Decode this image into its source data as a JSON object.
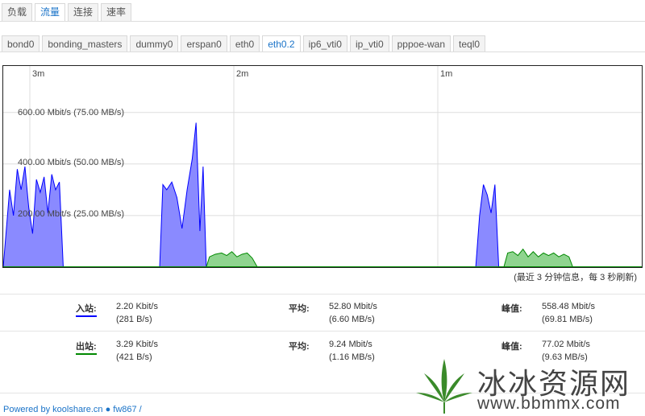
{
  "tabs": [
    {
      "label": "负载",
      "active": false
    },
    {
      "label": "流量",
      "active": true
    },
    {
      "label": "连接",
      "active": false
    },
    {
      "label": "速率",
      "active": false
    }
  ],
  "interfaces": [
    {
      "label": "bond0",
      "active": false
    },
    {
      "label": "bonding_masters",
      "active": false
    },
    {
      "label": "dummy0",
      "active": false
    },
    {
      "label": "erspan0",
      "active": false
    },
    {
      "label": "eth0",
      "active": false
    },
    {
      "label": "eth0.2",
      "active": true
    },
    {
      "label": "ip6_vti0",
      "active": false
    },
    {
      "label": "ip_vti0",
      "active": false
    },
    {
      "label": "pppoe-wan",
      "active": false
    },
    {
      "label": "teql0",
      "active": false
    }
  ],
  "chart": {
    "time_labels": [
      "3m",
      "2m",
      "1m"
    ],
    "y_labels": [
      "600.00 Mbit/s (75.00 MB/s)",
      "400.00 Mbit/s (50.00 MB/s)",
      "200.00 Mbit/s (25.00 MB/s)"
    ],
    "note": "(最近 3 分钟信息，每 3 秒刷新)"
  },
  "chart_data": {
    "type": "area",
    "ylabel": "Mbit/s",
    "ylim": [
      0,
      780
    ],
    "series": [
      {
        "name": "入站",
        "color": "#0000ff",
        "fill": "#8a8aff",
        "points": [
          [
            0,
            0
          ],
          [
            1.0,
            300
          ],
          [
            1.6,
            200
          ],
          [
            2.2,
            380
          ],
          [
            2.8,
            300
          ],
          [
            3.4,
            390
          ],
          [
            4.0,
            230
          ],
          [
            4.6,
            130
          ],
          [
            5.2,
            340
          ],
          [
            5.8,
            290
          ],
          [
            6.4,
            350
          ],
          [
            7.0,
            210
          ],
          [
            7.6,
            360
          ],
          [
            8.2,
            300
          ],
          [
            8.8,
            330
          ],
          [
            9.4,
            0
          ],
          [
            24.5,
            0
          ],
          [
            25,
            320
          ],
          [
            25.6,
            300
          ],
          [
            26.4,
            330
          ],
          [
            27.2,
            270
          ],
          [
            28.0,
            150
          ],
          [
            28.8,
            300
          ],
          [
            29.6,
            420
          ],
          [
            30.2,
            560
          ],
          [
            30.8,
            140
          ],
          [
            31.3,
            390
          ],
          [
            31.8,
            0
          ],
          [
            74,
            0
          ],
          [
            74.6,
            200
          ],
          [
            75.2,
            320
          ],
          [
            75.8,
            280
          ],
          [
            76.4,
            210
          ],
          [
            77.0,
            320
          ],
          [
            77.6,
            0
          ]
        ]
      },
      {
        "name": "出站",
        "color": "#008800",
        "fill": "#8fd48f",
        "points": [
          [
            31.8,
            0
          ],
          [
            32.3,
            40
          ],
          [
            33.2,
            50
          ],
          [
            34.2,
            55
          ],
          [
            35.0,
            45
          ],
          [
            35.8,
            60
          ],
          [
            36.6,
            40
          ],
          [
            37.4,
            50
          ],
          [
            38.2,
            55
          ],
          [
            39.0,
            35
          ],
          [
            39.8,
            0
          ],
          [
            78.4,
            0
          ],
          [
            79,
            55
          ],
          [
            79.8,
            60
          ],
          [
            80.6,
            45
          ],
          [
            81.4,
            70
          ],
          [
            82.2,
            40
          ],
          [
            83.0,
            60
          ],
          [
            83.8,
            40
          ],
          [
            84.6,
            55
          ],
          [
            85.4,
            45
          ],
          [
            86.2,
            55
          ],
          [
            87.0,
            40
          ],
          [
            87.8,
            50
          ],
          [
            88.6,
            40
          ],
          [
            89.2,
            0
          ]
        ]
      }
    ]
  },
  "stats": [
    {
      "label": "入站:",
      "color": "#0000ff",
      "cur": "2.20 Kbit/s",
      "cur_b": "(281 B/s)",
      "avg_label": "平均:",
      "avg": "52.80 Mbit/s",
      "avg_b": "(6.60 MB/s)",
      "peak_label": "峰值:",
      "peak": "558.48 Mbit/s",
      "peak_b": "(69.81 MB/s)"
    },
    {
      "label": "出站:",
      "color": "#008800",
      "cur": "3.29 Kbit/s",
      "cur_b": "(421 B/s)",
      "avg_label": "平均:",
      "avg": "9.24 Mbit/s",
      "avg_b": "(1.16 MB/s)",
      "peak_label": "峰值:",
      "peak": "77.02 Mbit/s",
      "peak_b": "(9.63 MB/s)"
    }
  ],
  "footer": {
    "text": "Powered by koolshare.cn ● fw867 /"
  },
  "watermark": {
    "cn": "冰冰资源网",
    "url": "www.bbmmx.com"
  }
}
